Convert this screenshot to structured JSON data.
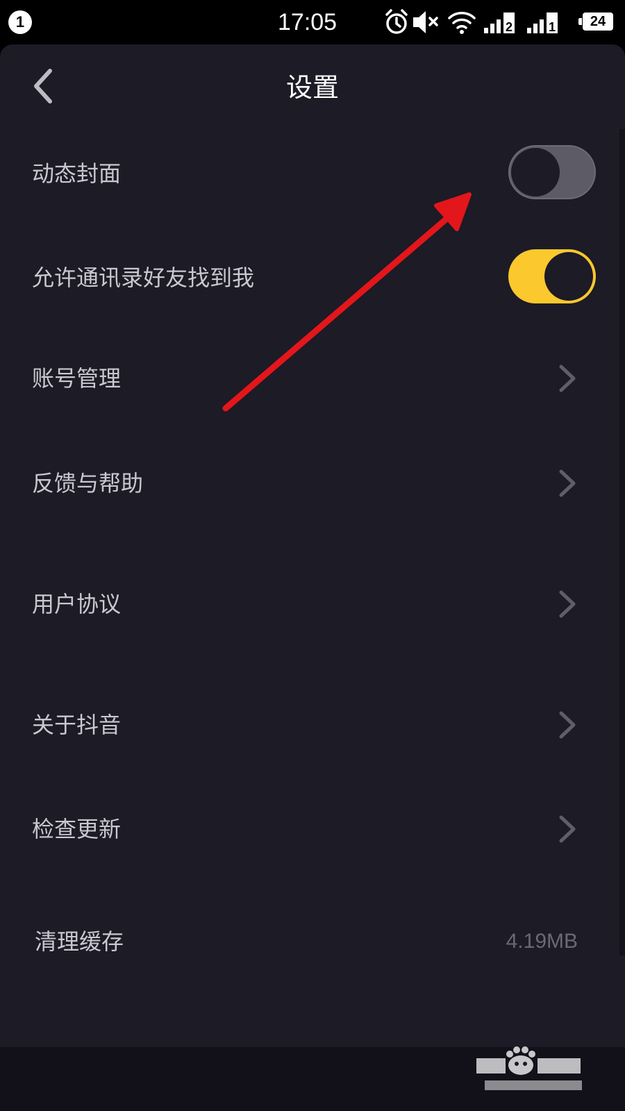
{
  "status_bar": {
    "notification_count": "1",
    "time": "17:05",
    "battery": "24",
    "icons": [
      "alarm-icon",
      "mute-icon",
      "wifi-icon",
      "signal-sim2-icon",
      "signal-sim1-icon",
      "battery-icon"
    ],
    "sim_labels": [
      "2",
      "1"
    ]
  },
  "nav": {
    "back_icon": "chevron-left-icon",
    "title": "设置"
  },
  "settings": {
    "dynamic_cover": {
      "label": "动态封面",
      "enabled": false
    },
    "contacts_find_me": {
      "label": "允许通讯录好友找到我",
      "enabled": true
    },
    "account": {
      "label": "账号管理"
    },
    "feedback": {
      "label": "反馈与帮助"
    },
    "agreement": {
      "label": "用户协议"
    },
    "about": {
      "label": "关于抖音"
    },
    "update": {
      "label": "检查更新"
    },
    "clear_cache": {
      "label": "清理缓存",
      "value": "4.19MB"
    }
  },
  "colors": {
    "background": "#1c1b26",
    "accent_yellow": "#fbc82d",
    "toggle_off": "#5c5b66",
    "annotation_red": "#e3161b"
  }
}
